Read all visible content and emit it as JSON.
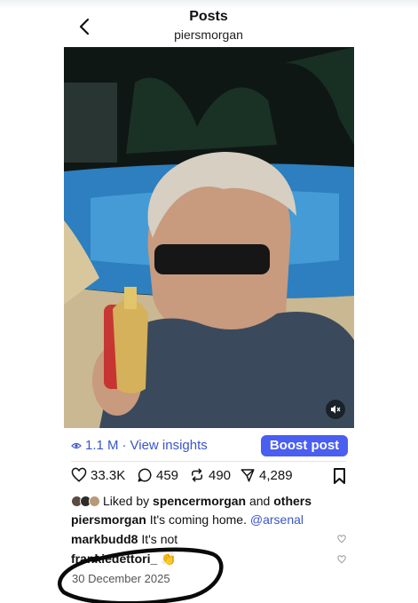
{
  "header": {
    "title": "Posts",
    "username": "piersmorgan",
    "back_icon": "chevron-left-icon"
  },
  "post": {
    "mute_icon": "speaker-muted-icon",
    "views": "1.1 M",
    "insights_label": "View insights",
    "boost_label": "Boost post",
    "accent_color": "#4a5ef0",
    "link_color": "#3a55cc"
  },
  "actions": {
    "likes": "33.3K",
    "comments": "459",
    "reposts": "490",
    "shares": "4,289"
  },
  "liked_by": {
    "prefix": "Liked by",
    "user": "spencermorgan",
    "and": "and",
    "others": "others"
  },
  "caption": {
    "user": "piersmorgan",
    "text": "It's coming home.",
    "mention": "@arsenal"
  },
  "comments": [
    {
      "user": "markbudd8",
      "text": "It's not"
    },
    {
      "user": "frankiedettori_",
      "text": "👏"
    }
  ],
  "date": "30 December 2025"
}
